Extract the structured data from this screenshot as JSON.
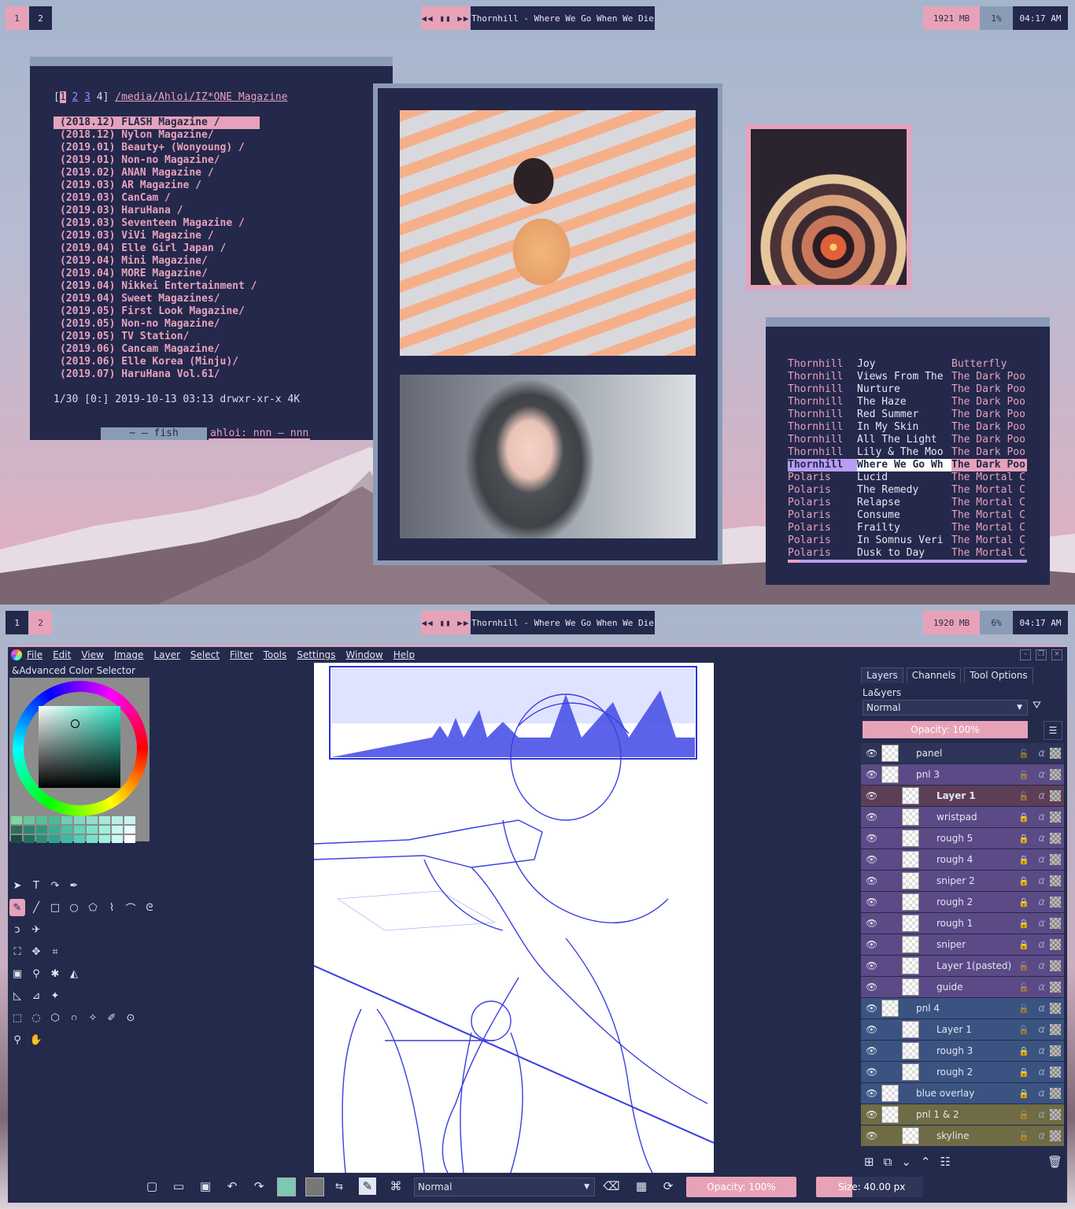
{
  "top_bar": {
    "workspaces": [
      "1",
      "2"
    ],
    "active_workspace": "1",
    "media_controls": "◀◀ ▮▮ ▶▶",
    "now_playing": "Thornhill - Where We Go When We Die",
    "memory": "1921 MB",
    "cpu": "1%",
    "clock": "04:17 AM"
  },
  "bottom_bar": {
    "workspaces": [
      "1",
      "2"
    ],
    "active_workspace": "2",
    "media_controls": "◀◀ ▮▮ ▶▶",
    "now_playing": "Thornhill - Where We Go When We Die",
    "memory": "1920 MB",
    "cpu": "6%",
    "clock": "04:17 AM"
  },
  "file_manager": {
    "tabs_prefix": "[",
    "tab_active": "1",
    "tab_2": "2",
    "tab_3": "3",
    "tab_4": " 4]",
    "path": "/media/Ahloi/IZ*ONE Magazine",
    "entries": [
      "(2018.12) FLASH Magazine /",
      "(2018.12) Nylon Magazine/",
      "(2019.01) Beauty+ (Wonyoung) /",
      "(2019.01) Non-no Magazine/",
      "(2019.02) ANAN Magazine /",
      "(2019.03) AR Magazine /",
      "(2019.03) CanCam /",
      "(2019.03) HaruHana /",
      "(2019.03) Seventeen Magazine /",
      "(2019.03) ViVi Magazine /",
      "(2019.04) Elle Girl Japan /",
      "(2019.04) Mini Magazine/",
      "(2019.04) MORE Magazine/",
      "(2019.04) Nikkei Entertainment /",
      "(2019.04) Sweet Magazines/",
      "(2019.05) First Look Magazine/",
      "(2019.05) Non-no Magazine/",
      "(2019.05) TV Station/",
      "(2019.06) Cancam Magazine/",
      "(2019.06) Elle Korea (Minju)/",
      "(2019.07) HaruHana Vol.61/"
    ],
    "status": "1/30 [0:] 2019-10-13 03:13 drwxr-xr-x 4K",
    "terminal_tab_1": "~ — fish",
    "terminal_tab_2": "ahloi: nnn — nnn"
  },
  "player": {
    "tracks": [
      [
        "Thornhill",
        "Joy",
        "Butterfly"
      ],
      [
        "Thornhill",
        "Views From The",
        "The Dark Poo"
      ],
      [
        "Thornhill",
        "Nurture",
        "The Dark Poo"
      ],
      [
        "Thornhill",
        "The Haze",
        "The Dark Poo"
      ],
      [
        "Thornhill",
        "Red Summer",
        "The Dark Poo"
      ],
      [
        "Thornhill",
        "In My Skin",
        "The Dark Poo"
      ],
      [
        "Thornhill",
        "All The Light",
        "The Dark Poo"
      ],
      [
        "Thornhill",
        "Lily & The Moo",
        "The Dark Poo"
      ],
      [
        "Thornhill",
        "Where We Go Wh",
        "The Dark Poo"
      ],
      [
        "Polaris",
        "Lucid",
        "The Mortal C"
      ],
      [
        "Polaris",
        "The Remedy",
        "The Mortal C"
      ],
      [
        "Polaris",
        "Relapse",
        "The Mortal C"
      ],
      [
        "Polaris",
        "Consume",
        "The Mortal C"
      ],
      [
        "Polaris",
        "Frailty",
        "The Mortal C"
      ],
      [
        "Polaris",
        "In Somnus Veri",
        "The Mortal C"
      ],
      [
        "Polaris",
        "Dusk to Day",
        "The Mortal C"
      ]
    ],
    "playing_index": 8,
    "progress_fraction": 0.05
  },
  "krita": {
    "menu": [
      "File",
      "Edit",
      "View",
      "Image",
      "Layer",
      "Select",
      "Filter",
      "Tools",
      "Settings",
      "Window",
      "Help"
    ],
    "color_docker_title": "&Advanced Color Selector",
    "swatches": [
      "#7ed8a0",
      "#69c79a",
      "#5cbf98",
      "#4fb896",
      "#6ccfb5",
      "#7fd8c3",
      "#8fe0d0",
      "#a6eadc",
      "#b7f0e8",
      "#c6f6f0",
      "#2e6e5a",
      "#2f8470",
      "#31987f",
      "#3cae92",
      "#4ac3a5",
      "#63d6bb",
      "#7ee3cb",
      "#a0eedc",
      "#c9f8ee",
      "#e6fff9",
      "#1c4d40",
      "#207060",
      "#27907b",
      "#2ea58e",
      "#3ebaa1",
      "#53d0b5",
      "#77e2cc",
      "#9ef0e0",
      "#cbfbf3",
      "#ffffff"
    ],
    "layers_tabs": [
      "Layers",
      "Channels",
      "Tool Options"
    ],
    "layers_title": "La&yers",
    "blend_mode": "Normal",
    "layer_opacity": "Opacity:  100%",
    "layers": [
      {
        "name": "panel",
        "indent": 0,
        "color": "default",
        "locked": false,
        "bold": false
      },
      {
        "name": "pnl 3",
        "indent": 0,
        "color": "purple",
        "locked": false,
        "bold": false
      },
      {
        "name": "Layer 1",
        "indent": 1,
        "color": "sel",
        "locked": false,
        "bold": true
      },
      {
        "name": "wristpad",
        "indent": 1,
        "color": "purple",
        "locked": true,
        "bold": false
      },
      {
        "name": "rough 5",
        "indent": 1,
        "color": "purple",
        "locked": true,
        "bold": false
      },
      {
        "name": "rough 4",
        "indent": 1,
        "color": "purple",
        "locked": true,
        "bold": false
      },
      {
        "name": "sniper 2",
        "indent": 1,
        "color": "purple",
        "locked": true,
        "bold": false
      },
      {
        "name": "rough 2",
        "indent": 1,
        "color": "purple",
        "locked": true,
        "bold": false
      },
      {
        "name": "rough 1",
        "indent": 1,
        "color": "purple",
        "locked": true,
        "bold": false
      },
      {
        "name": "sniper",
        "indent": 1,
        "color": "purple",
        "locked": true,
        "bold": false
      },
      {
        "name": "Layer 1(pasted)",
        "indent": 1,
        "color": "purple",
        "locked": false,
        "bold": false
      },
      {
        "name": "guide",
        "indent": 1,
        "color": "purple",
        "locked": false,
        "bold": false
      },
      {
        "name": "pnl 4",
        "indent": 0,
        "color": "blue",
        "locked": false,
        "bold": false
      },
      {
        "name": "Layer 1",
        "indent": 1,
        "color": "blue",
        "locked": false,
        "bold": false
      },
      {
        "name": "rough 3",
        "indent": 1,
        "color": "blue",
        "locked": true,
        "bold": false
      },
      {
        "name": "rough 2",
        "indent": 1,
        "color": "blue",
        "locked": true,
        "bold": false
      },
      {
        "name": "blue overlay",
        "indent": 0,
        "color": "blue",
        "locked": true,
        "bold": false
      },
      {
        "name": "pnl 1 & 2",
        "indent": 0,
        "color": "olive",
        "locked": false,
        "bold": false
      },
      {
        "name": "skyline",
        "indent": 1,
        "color": "olive",
        "locked": false,
        "bold": false
      }
    ],
    "bottom_blend_mode": "Normal",
    "brush_opacity": "Opacity: 100%",
    "brush_size": "Size: 40.00 px"
  },
  "colors": {
    "accent_pink": "#e6a2bc",
    "navy": "#24284b",
    "slate": "#8a9bb6",
    "lavender": "#b89df5",
    "ink_blue": "#3a3fe0"
  }
}
